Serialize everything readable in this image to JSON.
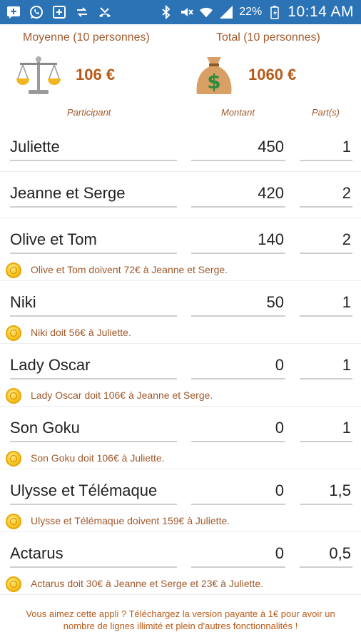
{
  "status_bar": {
    "battery": "22%",
    "time": "10:14 AM",
    "left_icons": [
      "message-add-icon",
      "whatsapp-icon",
      "plus-box-icon",
      "transfer-icon",
      "missed-call-icon"
    ],
    "right_icons": [
      "bluetooth-icon",
      "mute-icon",
      "wifi-icon",
      "signal-icon"
    ]
  },
  "summary": {
    "average_label": "Moyenne (10 personnes)",
    "average_value": "106 €",
    "total_label": "Total (10 personnes)",
    "total_value": "1060 €"
  },
  "columns": {
    "participant": "Participant",
    "amount": "Montant",
    "shares": "Part(s)"
  },
  "rows": [
    {
      "name": "Juliette",
      "amount": "450",
      "shares": "1",
      "note": ""
    },
    {
      "name": "Jeanne et Serge",
      "amount": "420",
      "shares": "2",
      "note": ""
    },
    {
      "name": "Olive et Tom",
      "amount": "140",
      "shares": "2",
      "note": "Olive et Tom doivent 72€ à Jeanne et Serge."
    },
    {
      "name": "Niki",
      "amount": "50",
      "shares": "1",
      "note": "Niki doit 56€ à Juliette."
    },
    {
      "name": "Lady Oscar",
      "amount": "0",
      "shares": "1",
      "note": "Lady Oscar doit 106€ à Jeanne et Serge."
    },
    {
      "name": "Son Goku",
      "amount": "0",
      "shares": "1",
      "note": "Son Goku doit 106€ à Juliette."
    },
    {
      "name": "Ulysse et Télémaque",
      "amount": "0",
      "shares": "1,5",
      "note": "Ulysse et Télémaque doivent 159€ à Juliette."
    },
    {
      "name": "Actarus",
      "amount": "0",
      "shares": "0,5",
      "note": "Actarus doit 30€ à Jeanne et Serge et 23€ à Juliette."
    }
  ],
  "promo": {
    "line1": "Vous aimez cette appli ? Téléchargez la version payante à 1€ pour avoir un",
    "line2": "nombre de lignes illimité et plein d'autres fonctionnalités !"
  },
  "colors": {
    "status_bar": "#2b73b5",
    "accent_text": "#a05a2c",
    "value_text": "#b85a17"
  }
}
